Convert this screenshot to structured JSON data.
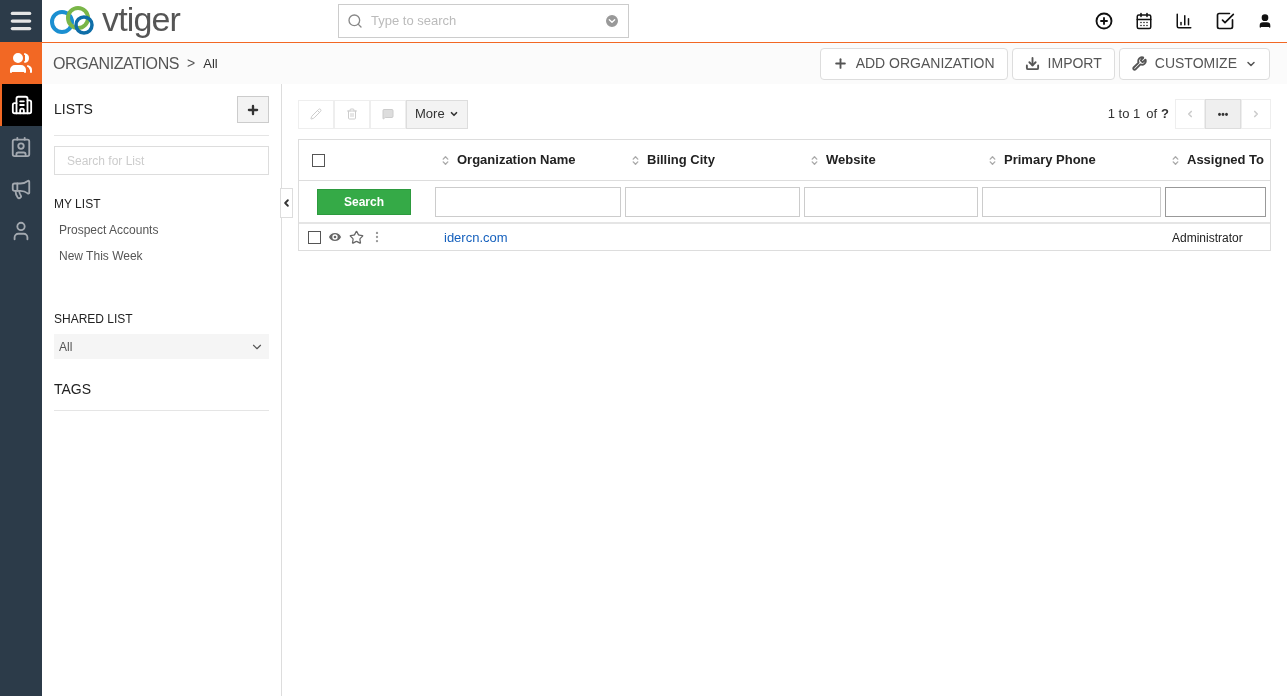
{
  "logo": {
    "text": "vtiger"
  },
  "search": {
    "placeholder": "Type to search"
  },
  "rail": [
    {
      "kind": "building",
      "selected": true
    },
    {
      "kind": "contact",
      "selected": false
    },
    {
      "kind": "megaphone",
      "selected": false
    },
    {
      "kind": "person",
      "selected": false
    }
  ],
  "breadcrumb": {
    "module": "ORGANIZATIONS",
    "separator": ">",
    "view": "All"
  },
  "header_buttons": [
    {
      "kind": "add",
      "label": "ADD ORGANIZATION"
    },
    {
      "kind": "import",
      "label": "IMPORT"
    },
    {
      "kind": "customize",
      "label": "CUSTOMIZE"
    }
  ],
  "lists_panel": {
    "title": "LISTS",
    "search_placeholder": "Search for List",
    "my_list_title": "MY LIST",
    "my_list": [
      "Prospect Accounts",
      "New This Week"
    ],
    "shared_list_title": "SHARED LIST",
    "shared_list_value": "All",
    "tags_title": "TAGS"
  },
  "toolbar": {
    "more_label": "More",
    "pagination": "1 to 1",
    "of_label": "of",
    "total": "?",
    "page_button": "•••"
  },
  "table": {
    "select_all_checked": false,
    "columns": [
      "Organization Name",
      "Billing City",
      "Website",
      "Primary Phone",
      "Assigned To"
    ],
    "search_button": "Search",
    "rows": [
      {
        "checked": false,
        "starred": false,
        "cells": [
          "idercn.com",
          "",
          "",
          "",
          "Administrator"
        ]
      }
    ]
  }
}
